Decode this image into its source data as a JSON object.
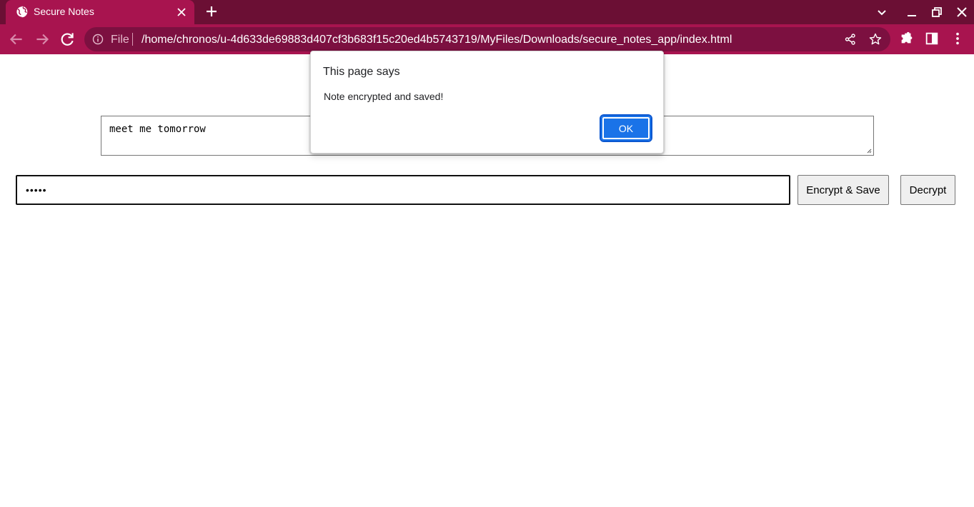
{
  "browser": {
    "tab": {
      "title": "Secure Notes"
    },
    "omnibox": {
      "scheme_label": "File",
      "url": "/home/chronos/u-4d633de69883d407cf3b683f15c20ed4b5743719/MyFiles/Downloads/secure_notes_app/index.html"
    },
    "colors": {
      "tabstrip": "#6b0f34",
      "toolbar": "#a8144f",
      "omnibox": "#7c1040"
    }
  },
  "page": {
    "note_text": "meet me tomorrow",
    "password_masked": "•••••",
    "encrypt_label": "Encrypt & Save",
    "decrypt_label": "Decrypt"
  },
  "dialog": {
    "title": "This page says",
    "message": "Note encrypted and saved!",
    "ok_label": "OK",
    "accent": "#1a73e8"
  }
}
